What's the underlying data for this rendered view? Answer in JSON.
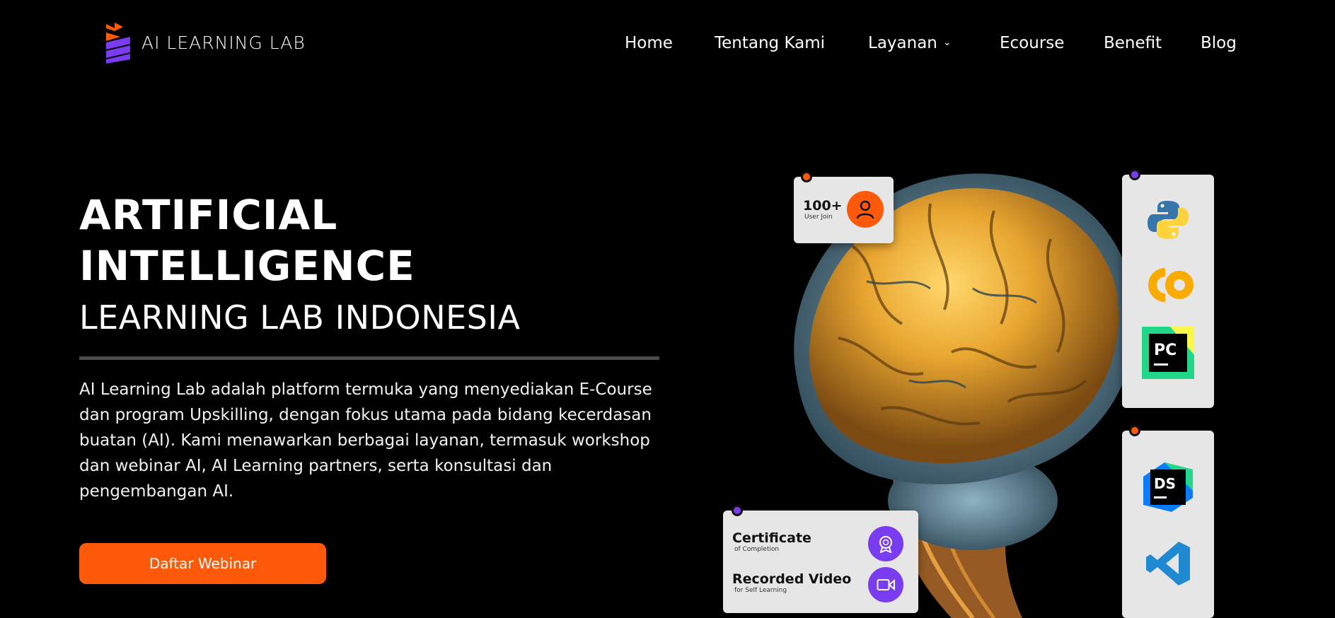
{
  "brand": {
    "name": "AI LEARNING LAB",
    "accent": "#ff5a0a",
    "purple": "#7a3cf0"
  },
  "nav": {
    "items": [
      {
        "label": "Home"
      },
      {
        "label": "Tentang Kami"
      },
      {
        "label": "Layanan"
      },
      {
        "label": "Ecourse"
      },
      {
        "label": "Benefit"
      },
      {
        "label": "Blog"
      }
    ]
  },
  "hero": {
    "title_line1": "ARTIFICIAL",
    "title_line2": "INTELLIGENCE",
    "subtitle": "LEARNING LAB INDONESIA",
    "description": "AI Learning Lab adalah platform termuka yang menyediakan E-Course dan program Upskilling, dengan fokus utama pada bidang kecerdasan buatan (AI). Kami menawarkan berbagai layanan, termasuk workshop dan webinar AI, AI Learning partners, serta konsultasi dan pengembangan AI.",
    "cta_label": "Daftar Webinar"
  },
  "cards": {
    "users": {
      "count": "100+",
      "label": "User Join",
      "icon": "user-icon"
    },
    "certificate": {
      "title": "Certificate",
      "subtitle": "of Completion",
      "icon": "award-icon"
    },
    "video": {
      "title": "Recorded Video",
      "subtitle": "for Self Learning",
      "icon": "video-camera-icon"
    },
    "tools": [
      {
        "icon": "python-icon"
      },
      {
        "icon": "colab-icon",
        "text": "CO"
      },
      {
        "icon": "pycharm-icon",
        "text": "PC"
      },
      {
        "icon": "dataspell-icon",
        "text": "DS"
      },
      {
        "icon": "vscode-icon"
      }
    ]
  }
}
